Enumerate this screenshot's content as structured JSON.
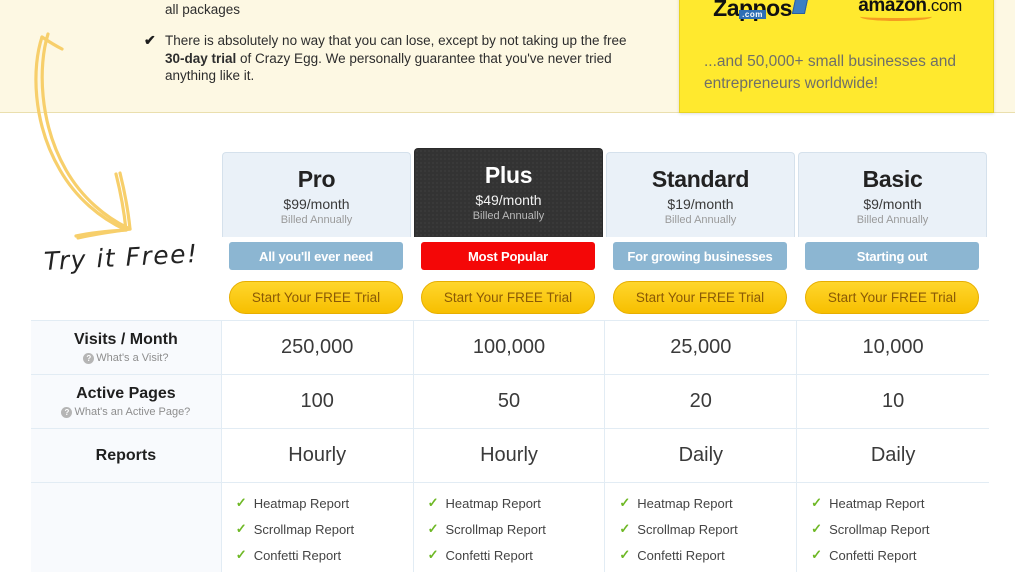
{
  "banner": {
    "partial_line": "all packages",
    "guarantee_items": [
      {
        "tick": "✔",
        "text_before": "There is absolutely no way that you can lose, except by not taking up the free ",
        "bold": "30-day trial",
        "text_after": " of Crazy Egg. We personally guarantee that you've never tried anything like it."
      }
    ]
  },
  "yellow_box": {
    "logos": [
      {
        "name": "zappos-logo",
        "text": "Zappos",
        "sub": ".com"
      },
      {
        "name": "amazon-logo",
        "text": "amazon",
        "dotcom": ".com"
      }
    ],
    "text": "...and 50,000+ small businesses and entrepreneurs worldwide!",
    "bg_color": "#ffe92e"
  },
  "promo": {
    "arrow_label": "hand-drawn-arrow",
    "arrow_color": "#f7cf6b",
    "try_it_free": "Try it Free!"
  },
  "pricing": {
    "plans": [
      {
        "name": "Pro",
        "price": "$99/month",
        "billed": "Billed Annually",
        "badge": "All you'll ever need",
        "badge_style": "blue",
        "cta": "Start Your FREE Trial",
        "highlighted": false
      },
      {
        "name": "Plus",
        "price": "$49/month",
        "billed": "Billed Annually",
        "badge": "Most Popular",
        "badge_style": "red",
        "cta": "Start Your FREE Trial",
        "highlighted": true
      },
      {
        "name": "Standard",
        "price": "$19/month",
        "billed": "Billed Annually",
        "badge": "For growing businesses",
        "badge_style": "blue",
        "cta": "Start Your FREE Trial",
        "highlighted": false
      },
      {
        "name": "Basic",
        "price": "$9/month",
        "billed": "Billed Annually",
        "badge": "Starting out",
        "badge_style": "blue",
        "cta": "Start Your FREE Trial",
        "highlighted": false
      }
    ],
    "rows": [
      {
        "label": "Visits / Month",
        "help": "What's a Visit?",
        "values": [
          "250,000",
          "100,000",
          "25,000",
          "10,000"
        ]
      },
      {
        "label": "Active Pages",
        "help": "What's an Active Page?",
        "values": [
          "100",
          "50",
          "20",
          "10"
        ]
      },
      {
        "label": "Reports",
        "help": "",
        "values": [
          "Hourly",
          "Hourly",
          "Daily",
          "Daily"
        ]
      }
    ],
    "features_row": {
      "label": "",
      "columns": [
        [
          "Heatmap Report",
          "Scrollmap Report",
          "Confetti Report"
        ],
        [
          "Heatmap Report",
          "Scrollmap Report",
          "Confetti Report"
        ],
        [
          "Heatmap Report",
          "Scrollmap Report",
          "Confetti Report"
        ],
        [
          "Heatmap Report",
          "Scrollmap Report",
          "Confetti Report"
        ]
      ]
    },
    "tick_glyph": "✓",
    "colors": {
      "badge_blue": "#8cb6d2",
      "badge_red": "#f40707",
      "cta_yellow": "#f7bf00",
      "feature_tick_green": "#6eb825",
      "highlight_dark": "#333333"
    }
  }
}
